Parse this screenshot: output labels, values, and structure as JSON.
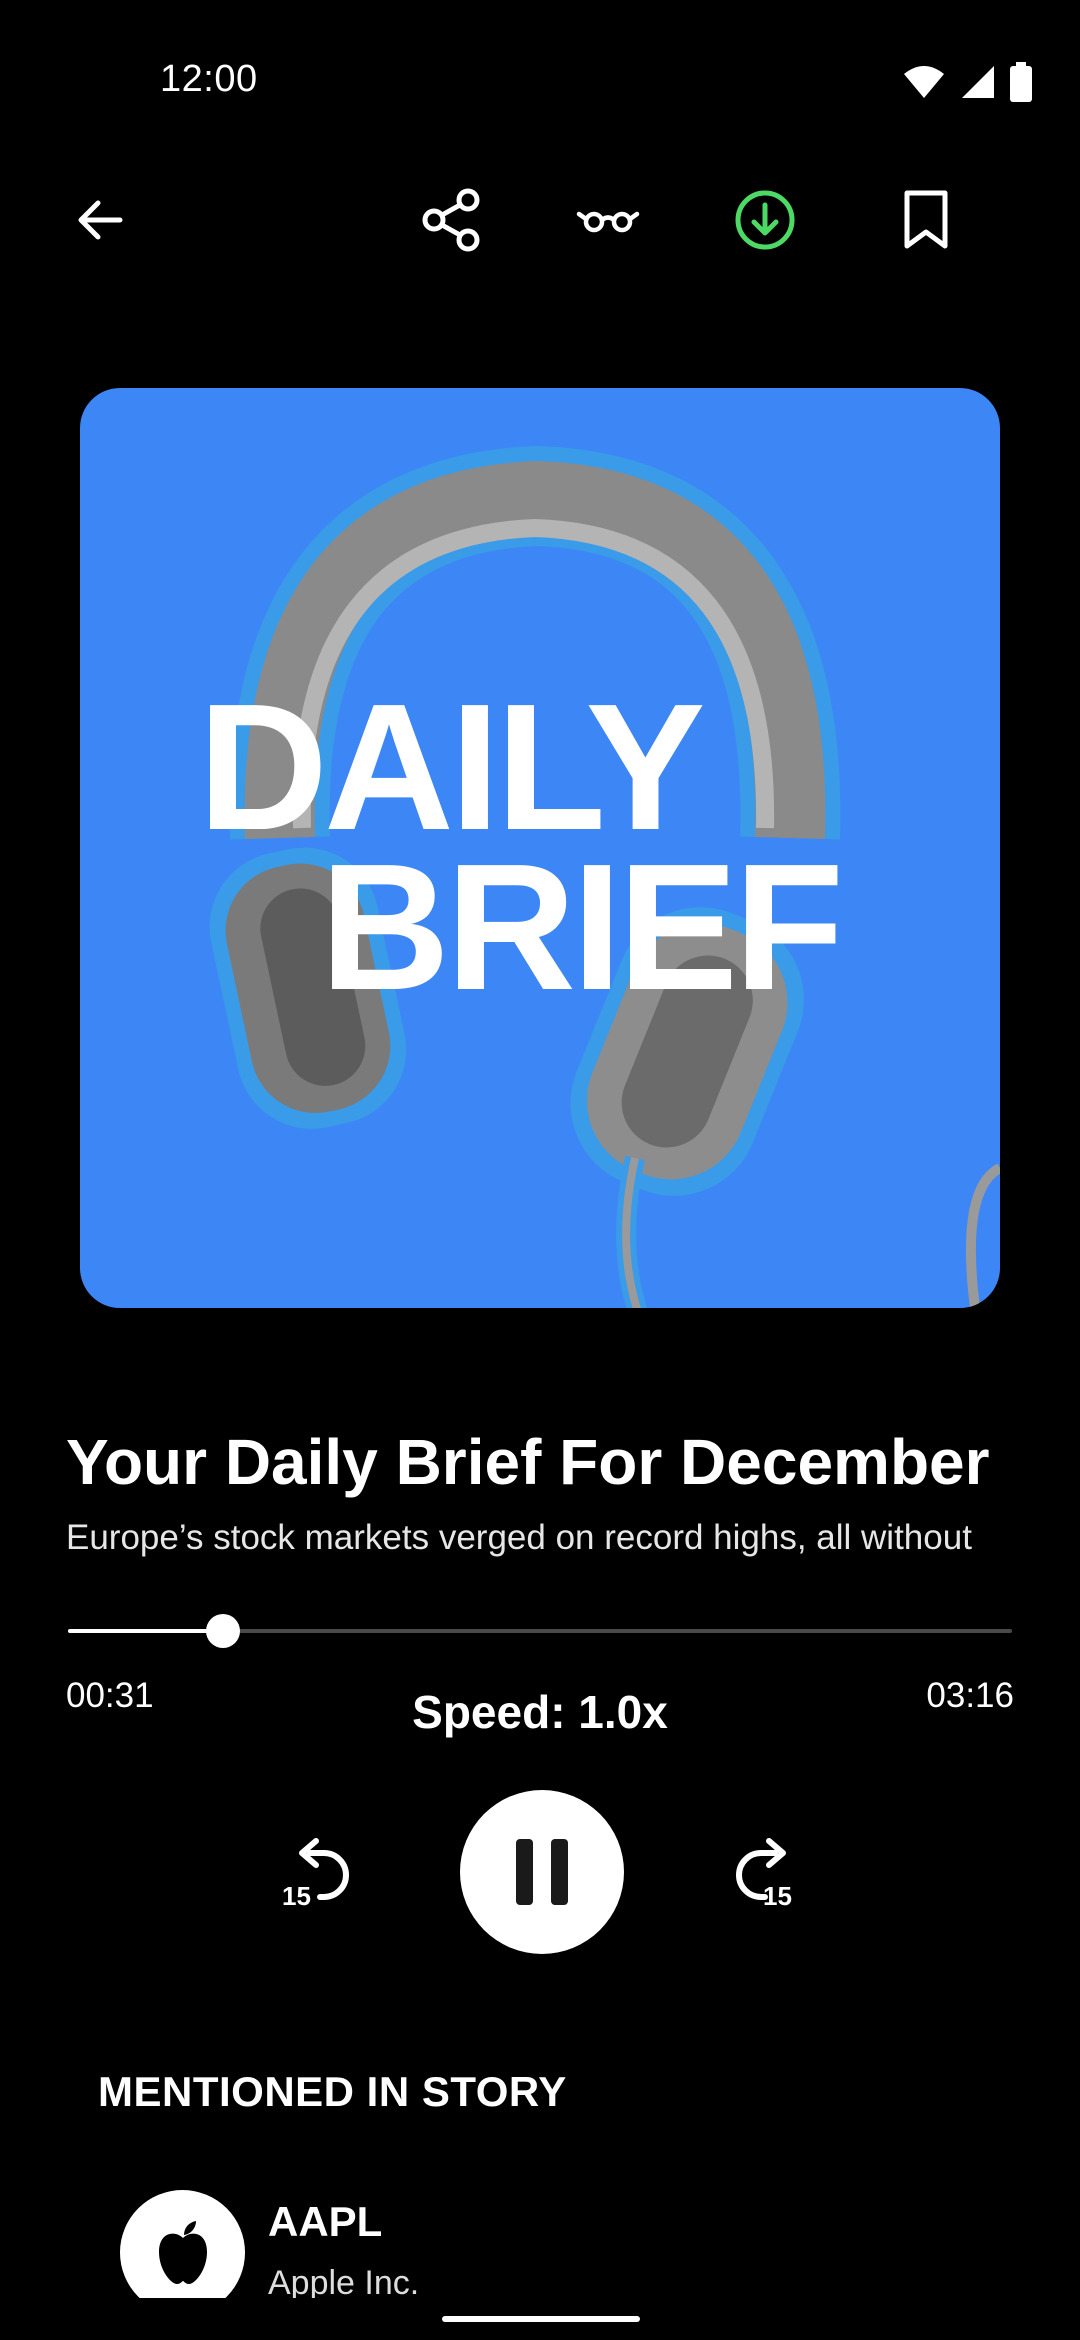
{
  "status_bar": {
    "time": "12:00"
  },
  "toolbar": {
    "icons": [
      "back-arrow-icon",
      "share-icon",
      "glasses-icon",
      "download-icon",
      "bookmark-icon"
    ],
    "download_color": "#4cd964"
  },
  "artwork": {
    "line1": "DAILY",
    "line2": "BRIEF",
    "background": "#3d86f5"
  },
  "episode": {
    "title": "Your Daily Brief For December",
    "description": "Europe’s stock markets verged on record highs, all without"
  },
  "player": {
    "current_time": "00:31",
    "total_time": "03:16",
    "progress": 0.164,
    "speed_label": "Speed: 1.0x",
    "rewind_label": "15",
    "forward_label": "15"
  },
  "mentioned": {
    "heading": "MENTIONED IN STORY",
    "items": [
      {
        "ticker": "AAPL",
        "name": "Apple Inc."
      }
    ]
  }
}
